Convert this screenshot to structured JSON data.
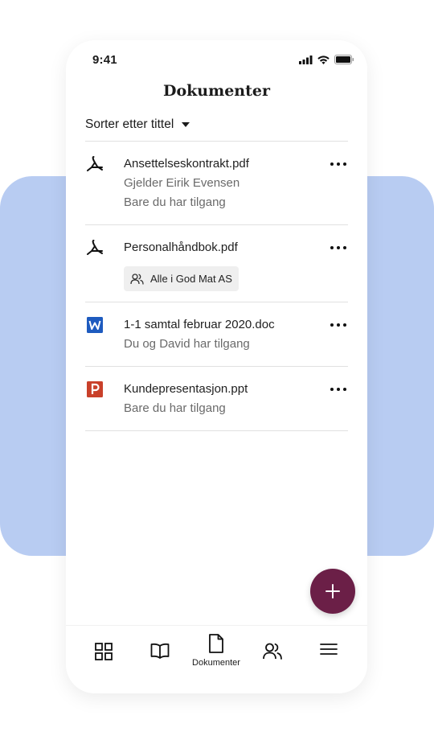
{
  "status": {
    "time": "9:41"
  },
  "header": {
    "title": "Dokumenter"
  },
  "sort": {
    "label": "Sorter etter tittel"
  },
  "documents": [
    {
      "name": "Ansettelseskontrakt.pdf",
      "type": "pdf",
      "icon": "pdf-icon",
      "lines": [
        "Gjelder Eirik Evensen",
        "Bare du har tilgang"
      ]
    },
    {
      "name": "Personalhåndbok.pdf",
      "type": "pdf",
      "icon": "pdf-icon",
      "chip": "Alle i God Mat AS"
    },
    {
      "name": "1-1 samtal februar 2020.doc",
      "type": "word",
      "icon": "word-icon",
      "lines": [
        "Du og David har tilgang"
      ]
    },
    {
      "name": "Kundepresentasjon.ppt",
      "type": "powerpoint",
      "icon": "powerpoint-icon",
      "lines": [
        "Bare du har tilgang"
      ]
    }
  ],
  "fab": {
    "icon": "plus-icon",
    "color": "#6b1f47"
  },
  "nav": {
    "items": [
      {
        "id": "dashboard",
        "icon": "grid-icon"
      },
      {
        "id": "handbook",
        "icon": "book-icon"
      },
      {
        "id": "documents",
        "icon": "document-icon",
        "label": "Dokumenter",
        "active": true
      },
      {
        "id": "people",
        "icon": "people-icon"
      },
      {
        "id": "menu",
        "icon": "menu-icon"
      }
    ]
  },
  "colors": {
    "background_accent": "#b8ccf2",
    "word_blue": "#1e5bbf",
    "powerpoint_red": "#c9402a"
  }
}
